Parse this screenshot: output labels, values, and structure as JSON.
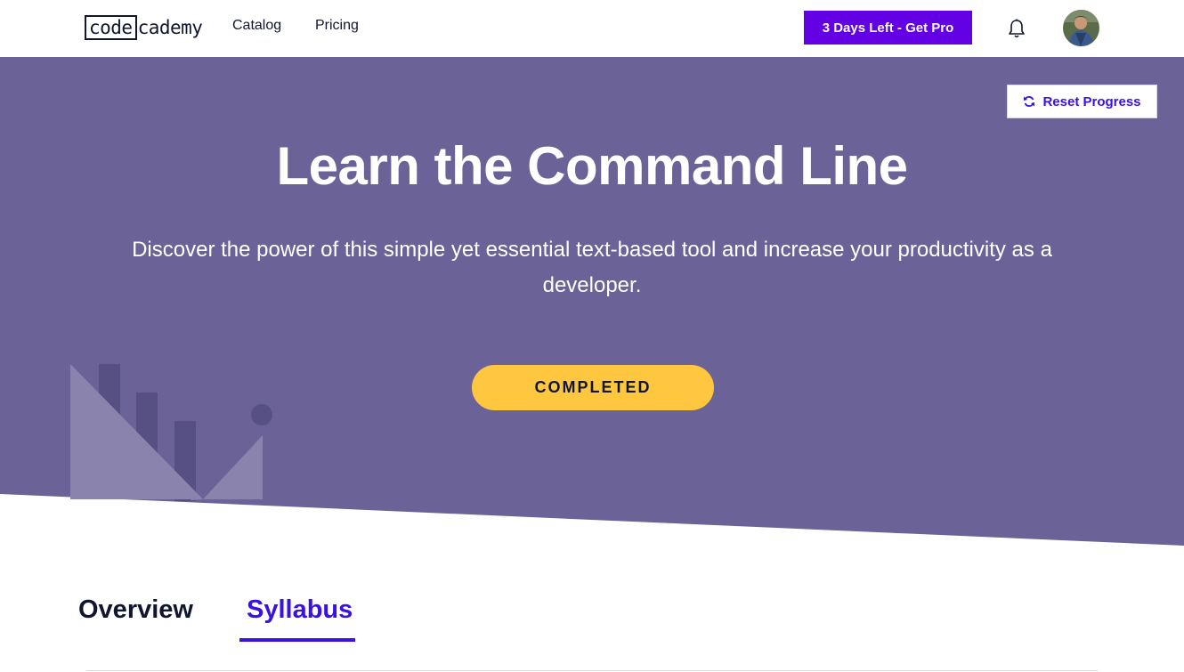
{
  "nav": {
    "logo_boxed": "code",
    "logo_rest": "cademy",
    "links": [
      "Catalog",
      "Pricing"
    ],
    "pro_button": "3 Days Left - Get Pro",
    "bell_icon": "bell-icon",
    "avatar_icon": "user-avatar"
  },
  "hero": {
    "reset_button": "Reset Progress",
    "reset_icon": "refresh-icon",
    "title": "Learn the Command Line",
    "description": "Discover the power of this simple yet essential text-based tool and increase your productivity as a developer.",
    "status_button": "COMPLETED"
  },
  "tabs": {
    "overview": "Overview",
    "syllabus": "Syllabus",
    "active": "Syllabus"
  },
  "colors": {
    "hero_bg": "#6b6398",
    "accent": "#3a10e5",
    "pro": "#6400e4",
    "completed": "#ffc740",
    "text_dark": "#10162f"
  }
}
